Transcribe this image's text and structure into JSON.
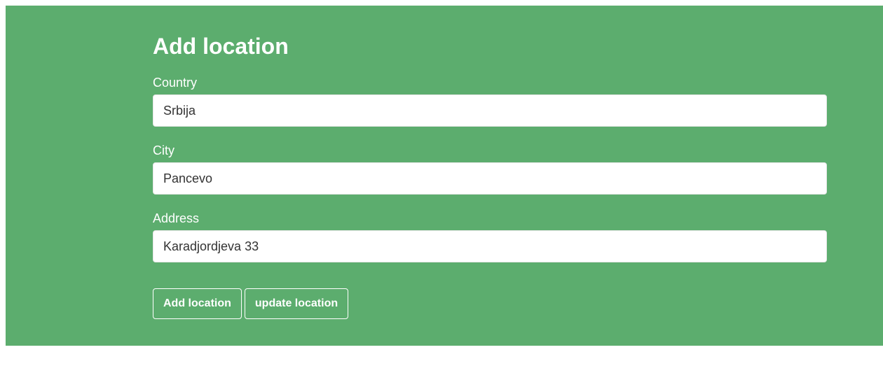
{
  "form": {
    "title": "Add location",
    "fields": [
      {
        "label": "Country",
        "value": "Srbija"
      },
      {
        "label": "City",
        "value": "Pancevo"
      },
      {
        "label": "Address",
        "value": "Karadjordjeva 33"
      }
    ],
    "buttons": {
      "add_label": "Add location",
      "update_label": "update location"
    }
  },
  "colors": {
    "panel_background": "#5cad6e",
    "text": "#ffffff",
    "input_background": "#ffffff"
  }
}
